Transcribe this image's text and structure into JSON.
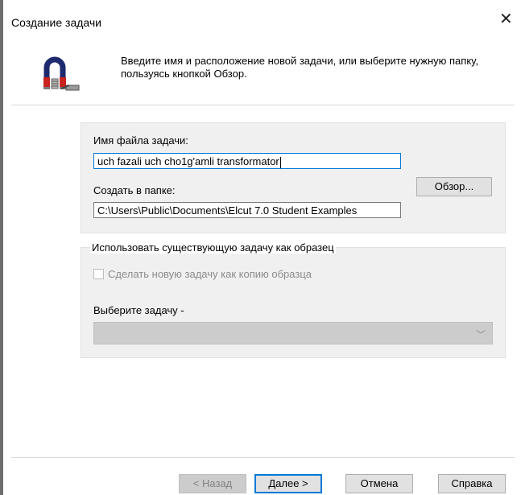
{
  "window": {
    "title": "Создание задачи",
    "close_glyph": "✕"
  },
  "header": {
    "instruction": "Введите имя и расположение новой задачи, или выберите нужную папку, пользуясь кнопкой Обзор.",
    "icon": "wizard-icon"
  },
  "form": {
    "filename_label": "Имя файла задачи:",
    "filename_value": "uch fazali uch cho1g'amli transformator",
    "folder_label": "Создать в папке:",
    "folder_value": "C:\\Users\\Public\\Documents\\Elcut 7.0 Student Examples",
    "browse_label": "Обзор..."
  },
  "template_group": {
    "legend": "Использовать существующую задачу как образец",
    "checkbox_label": "Сделать новую задачу как копию образца",
    "checkbox_checked": false,
    "select_label": "Выберите задачу -",
    "select_value": ""
  },
  "footer": {
    "back_label": "< Назад",
    "next_label": "Далее >",
    "cancel_label": "Отмена",
    "help_label": "Справка"
  }
}
